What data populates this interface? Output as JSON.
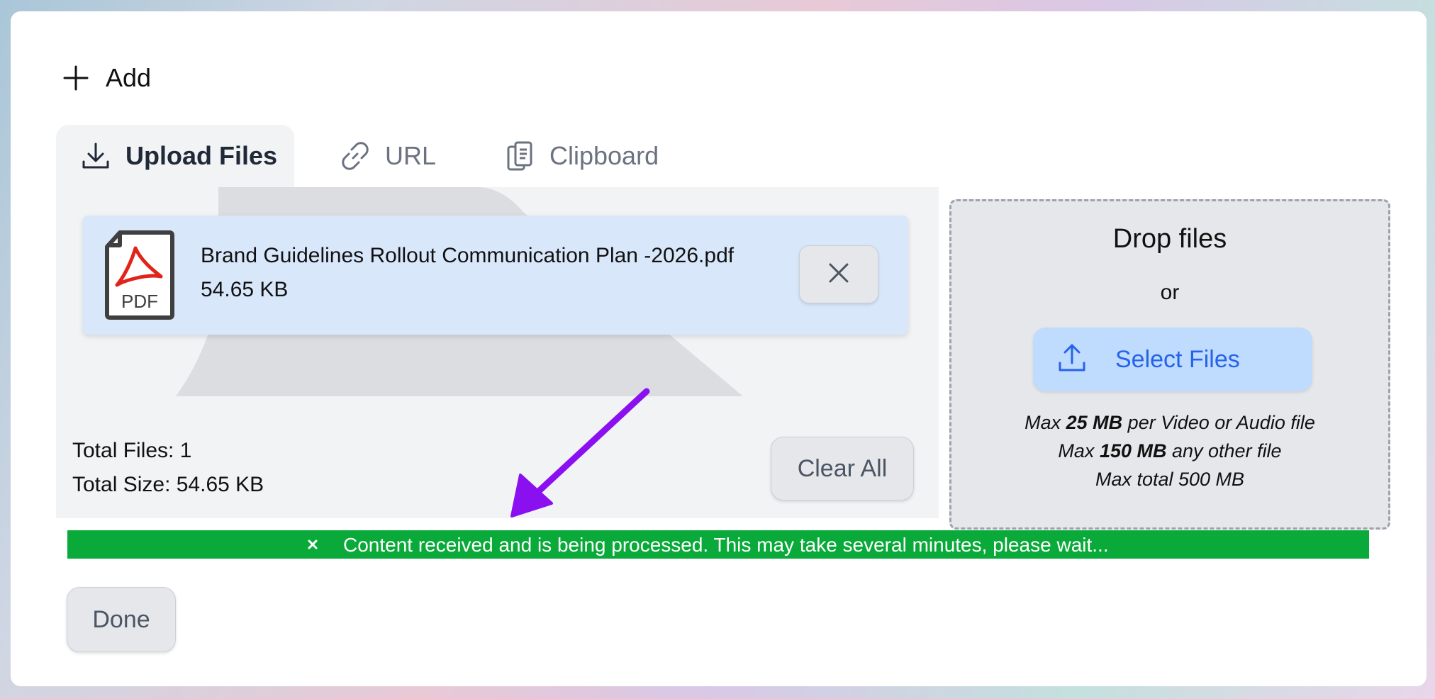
{
  "header": {
    "add_label": "Add"
  },
  "tabs": [
    {
      "label": "Upload Files",
      "icon": "download-icon",
      "active": true
    },
    {
      "label": "URL",
      "icon": "link-icon",
      "active": false
    },
    {
      "label": "Clipboard",
      "icon": "clipboard-icon",
      "active": false
    }
  ],
  "file_list": {
    "files": [
      {
        "name": "Brand Guidelines Rollout Communication Plan -2026.pdf",
        "size": "54.65 KB",
        "icon": "pdf-icon",
        "icon_text": "PDF"
      }
    ],
    "total_files": "Total Files: 1",
    "total_size": "Total Size: 54.65 KB",
    "clear_all_label": "Clear All"
  },
  "drop_zone": {
    "title": "Drop files",
    "or": "or",
    "select_label": "Select Files",
    "limit_1_prefix": "Max ",
    "limit_1_bold": "25 MB",
    "limit_1_suffix": " per Video or Audio file",
    "limit_2_prefix": "Max ",
    "limit_2_bold": "150 MB",
    "limit_2_suffix": " any other file",
    "limit_3": "Max total 500 MB"
  },
  "notification": {
    "message": "Content received and is being processed. This may take several minutes, please wait...",
    "color": "#0aaa3a"
  },
  "footer": {
    "done_label": "Done"
  },
  "colors": {
    "accent": "#2563eb",
    "annotation_arrow": "#8b10f0"
  }
}
